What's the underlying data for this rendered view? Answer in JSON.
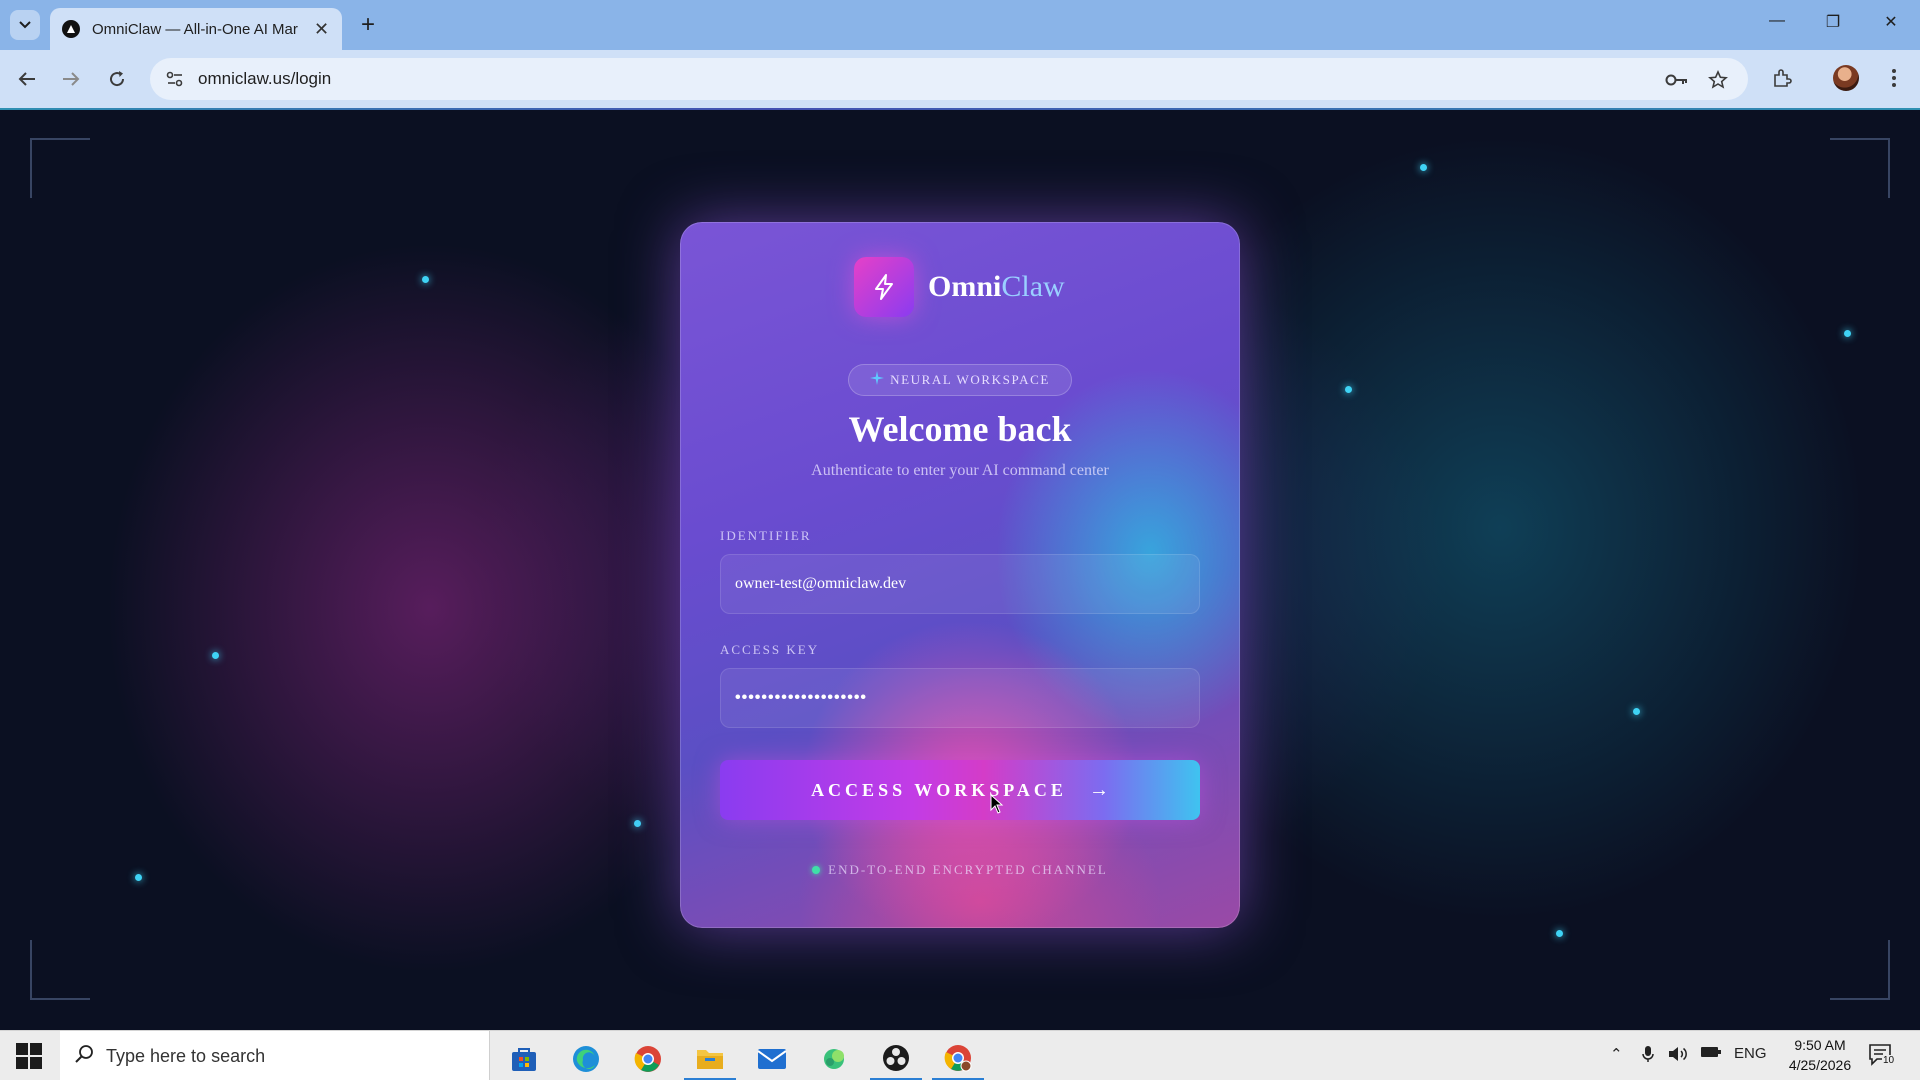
{
  "browser": {
    "tab_title": "OmniClaw — All-in-One AI Mar",
    "url": "omniclaw.us/login"
  },
  "brand": {
    "part1": "Omni",
    "part2": "Claw"
  },
  "login": {
    "badge": "NEURAL WORKSPACE",
    "heading": "Welcome back",
    "subheading": "Authenticate to enter your AI command center",
    "identifier_label": "IDENTIFIER",
    "identifier_value": "owner-test@omniclaw.dev",
    "access_key_label": "ACCESS KEY",
    "access_key_value": "••••••••••••••••••••",
    "submit_label": "ACCESS WORKSPACE",
    "submit_arrow": "→",
    "secure_note": "END-TO-END ENCRYPTED CHANNEL"
  },
  "taskbar": {
    "search_placeholder": "Type here to search",
    "language": "ENG",
    "time": "9:50 AM",
    "date": "4/25/2026",
    "notification_count": "10"
  },
  "colors": {
    "accent_magenta": "#d43cc8",
    "accent_cyan": "#3fc3f0",
    "accent_purple": "#8a3cf0",
    "status_green": "#3fe0a8"
  },
  "icons": [
    "tab-search-icon",
    "back-icon",
    "forward-icon",
    "reload-icon",
    "site-info-icon",
    "password-key-icon",
    "star-icon",
    "extensions-icon",
    "profile-avatar",
    "menu-icon",
    "bolt-icon",
    "sparkle-icon",
    "windows-start-icon",
    "search-icon"
  ]
}
